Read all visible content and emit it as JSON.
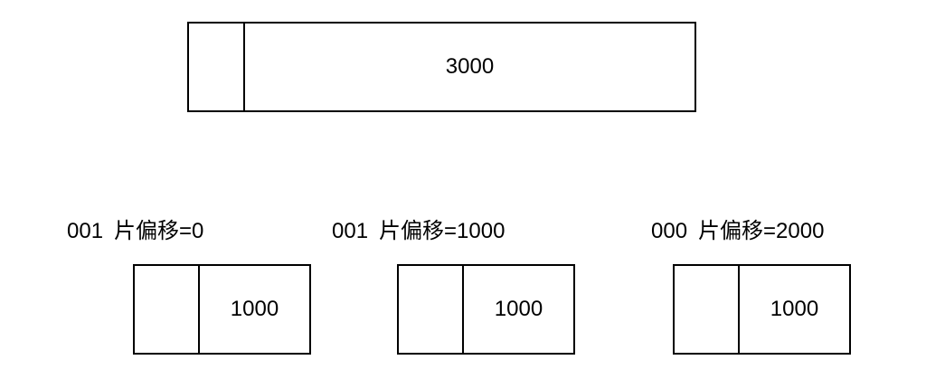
{
  "original_packet": {
    "header_text": "",
    "data_length": "3000"
  },
  "fragments": [
    {
      "flags": "001",
      "offset_label": "片偏移=0",
      "header_text": "",
      "data_length": "1000"
    },
    {
      "flags": "001",
      "offset_label": "片偏移=1000",
      "header_text": "",
      "data_length": "1000"
    },
    {
      "flags": "000",
      "offset_label": "片偏移=2000",
      "header_text": "",
      "data_length": "1000"
    }
  ]
}
